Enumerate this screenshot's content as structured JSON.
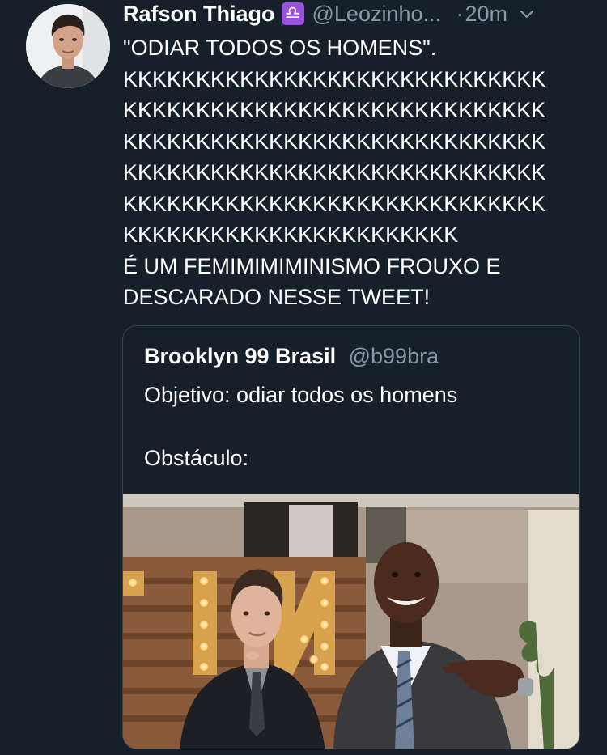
{
  "tweet": {
    "author_name": "Rafson Thiago",
    "libra_emoji": "♎",
    "handle": "@Leozinho...",
    "separator": "·",
    "time": "20m",
    "lines": [
      "\"ODIAR TODOS OS HOMENS\".",
      "KKKKKKKKKKKKKKKKKKKKKKKKKKKKK",
      "KKKKKKKKKKKKKKKKKKKKKKKKKKKKK",
      "KKKKKKKKKKKKKKKKKKKKKKKKKKKKK",
      "KKKKKKKKKKKKKKKKKKKKKKKKKKKKK",
      "KKKKKKKKKKKKKKKKKKKKKKKKKKKKK",
      "KKKKKKKKKKKKKKKKKKKKKKK",
      "É UM FEMIMIMIMINISMO FROUXO E",
      "DESCARADO NESSE TWEET!"
    ]
  },
  "quoted": {
    "name": "Brooklyn 99 Brasil",
    "handle": "@b99bra",
    "line1": "Objetivo: odiar todos os homens",
    "line2": "Obstáculo:",
    "image_sign_letters": "IN"
  },
  "icons": {
    "avatar": "profile-avatar",
    "chevron": "chevron-down-icon",
    "photo": "quoted-tweet-photo"
  },
  "colors": {
    "background": "#15202b",
    "muted": "#8899a6",
    "border": "#38444d",
    "libra_badge": "#9b51e0"
  }
}
